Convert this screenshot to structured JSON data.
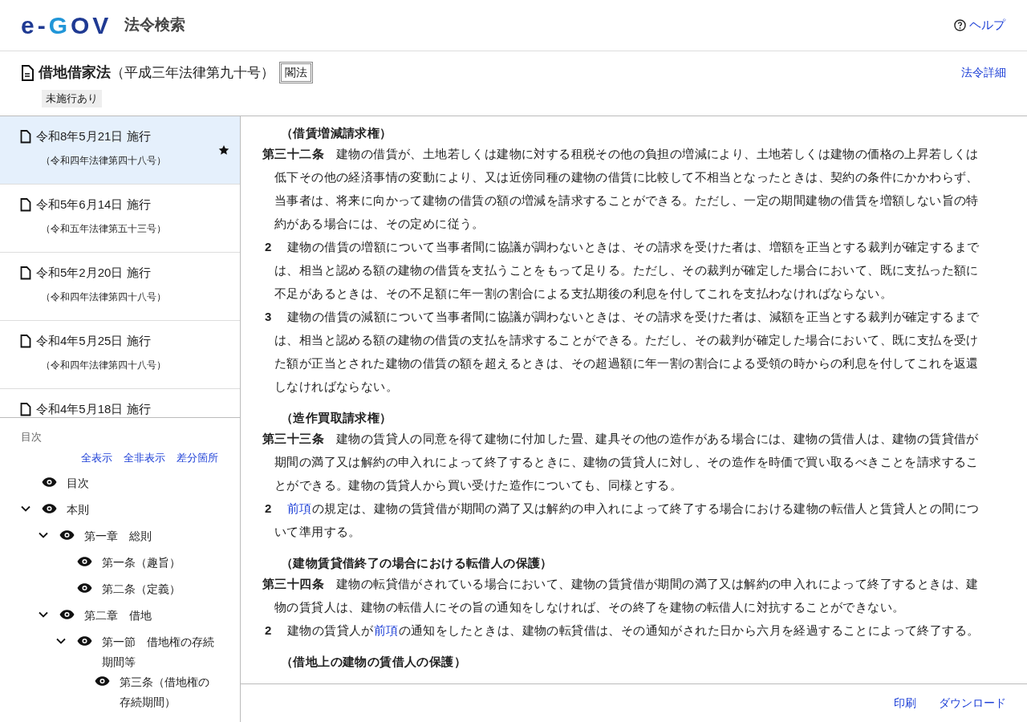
{
  "header": {
    "logo": [
      {
        "text": "e-",
        "color": "#1f3a93"
      },
      {
        "text": "G",
        "color": "#2196d8"
      },
      {
        "text": "OV",
        "color": "#1f3a93"
      }
    ],
    "site_title": "法令検索",
    "help_link": "ヘルプ"
  },
  "law": {
    "name": "借地借家法",
    "number": "（平成三年法律第九十号）",
    "tag": "閣法",
    "status_badge": "未施行あり",
    "detail_link": "法令詳細"
  },
  "versions": [
    {
      "date": "令和8年5月21日 施行",
      "law_number": "（令和四年法律第四十八号）",
      "selected": true,
      "starred": true
    },
    {
      "date": "令和5年6月14日 施行",
      "law_number": "（令和五年法律第五十三号）",
      "selected": false,
      "starred": false
    },
    {
      "date": "令和5年2月20日 施行",
      "law_number": "（令和四年法律第四十八号）",
      "selected": false,
      "starred": false
    },
    {
      "date": "令和4年5月25日 施行",
      "law_number": "（令和四年法律第四十八号）",
      "selected": false,
      "starred": false
    },
    {
      "date": "令和4年5月18日 施行",
      "selected": false,
      "starred": false
    }
  ],
  "toc": {
    "title": "目次",
    "actions": [
      "全表示",
      "全非表示",
      "差分箇所"
    ],
    "items": [
      {
        "label": "目次"
      },
      {
        "label": "本則",
        "expanded": true,
        "children": [
          {
            "label": "第一章　総則",
            "expanded": true,
            "children": [
              {
                "label": "第一条（趣旨）"
              },
              {
                "label": "第二条（定義）"
              }
            ]
          },
          {
            "label": "第二章　借地",
            "expanded": true,
            "children": [
              {
                "label": "第一節　借地権の存続期間等",
                "expanded": true,
                "children": [
                  {
                    "label": "第三条（借地権の存続期間）"
                  }
                ]
              }
            ]
          }
        ]
      }
    ]
  },
  "articles": [
    {
      "caption": "（借賃増減請求権）",
      "title": "第三十二条",
      "paragraphs": [
        {
          "parts": [
            {
              "kind": "text",
              "text": "建物の借賃が、土地若しくは建物に対する租税その他の負担の増減により、土地若しくは建物の価格の上昇若しくは低下その他の経済事情の変動により、又は近傍同種の建物の借賃に比較して不相当となったときは、契約の条件にかかわらず、当事者は、将来に向かって建物の借賃の額の増減を請求することができる。ただし、一定の期間建物の借賃を増額しない旨の特約がある場合には、その定めに従う。"
            }
          ]
        },
        {
          "num": "2",
          "parts": [
            {
              "kind": "text",
              "text": "建物の借賃の増額について当事者間に協議が調わないときは、その請求を受けた者は、増額を正当とする裁判が確定するまでは、相当と認める額の建物の借賃を支払うことをもって足りる。ただし、その裁判が確定した場合において、既に支払った額に不足があるときは、その不足額に年一割の割合による支払期後の利息を付してこれを支払わなければならない。"
            }
          ]
        },
        {
          "num": "3",
          "parts": [
            {
              "kind": "text",
              "text": "建物の借賃の減額について当事者間に協議が調わないときは、その請求を受けた者は、減額を正当とする裁判が確定するまでは、相当と認める額の建物の借賃の支払を請求することができる。ただし、その裁判が確定した場合において、既に支払を受けた額が正当とされた建物の借賃の額を超えるときは、その超過額に年一割の割合による受領の時からの利息を付してこれを返還しなければならない。"
            }
          ]
        }
      ]
    },
    {
      "caption": "（造作買取請求権）",
      "title": "第三十三条",
      "paragraphs": [
        {
          "parts": [
            {
              "kind": "text",
              "text": "建物の賃貸人の同意を得て建物に付加した畳、建具その他の造作がある場合には、建物の賃借人は、建物の賃貸借が期間の満了又は解約の申入れによって終了するときに、建物の賃貸人に対し、その造作を時価で買い取るべきことを請求することができる。建物の賃貸人から買い受けた造作についても、同様とする。"
            }
          ]
        },
        {
          "num": "2",
          "parts": [
            {
              "kind": "link",
              "text": "前項"
            },
            {
              "kind": "text",
              "text": "の規定は、建物の賃貸借が期間の満了又は解約の申入れによって終了する場合における建物の転借人と賃貸人との間について準用する。"
            }
          ]
        }
      ]
    },
    {
      "caption": "（建物賃貸借終了の場合における転借人の保護）",
      "title": "第三十四条",
      "paragraphs": [
        {
          "parts": [
            {
              "kind": "text",
              "text": "建物の転貸借がされている場合において、建物の賃貸借が期間の満了又は解約の申入れによって終了するときは、建物の賃貸人は、建物の転借人にその旨の通知をしなければ、その終了を建物の転借人に対抗することができない。"
            }
          ]
        },
        {
          "num": "2",
          "parts": [
            {
              "kind": "text",
              "text": "建物の賃貸人が"
            },
            {
              "kind": "link",
              "text": "前項"
            },
            {
              "kind": "text",
              "text": "の通知をしたときは、建物の転貸借は、その通知がされた日から六月を経過することによって終了する。"
            }
          ]
        }
      ]
    },
    {
      "caption": "（借地上の建物の賃借人の保護）"
    }
  ],
  "footer": {
    "actions": [
      "印刷",
      "ダウンロード"
    ]
  }
}
